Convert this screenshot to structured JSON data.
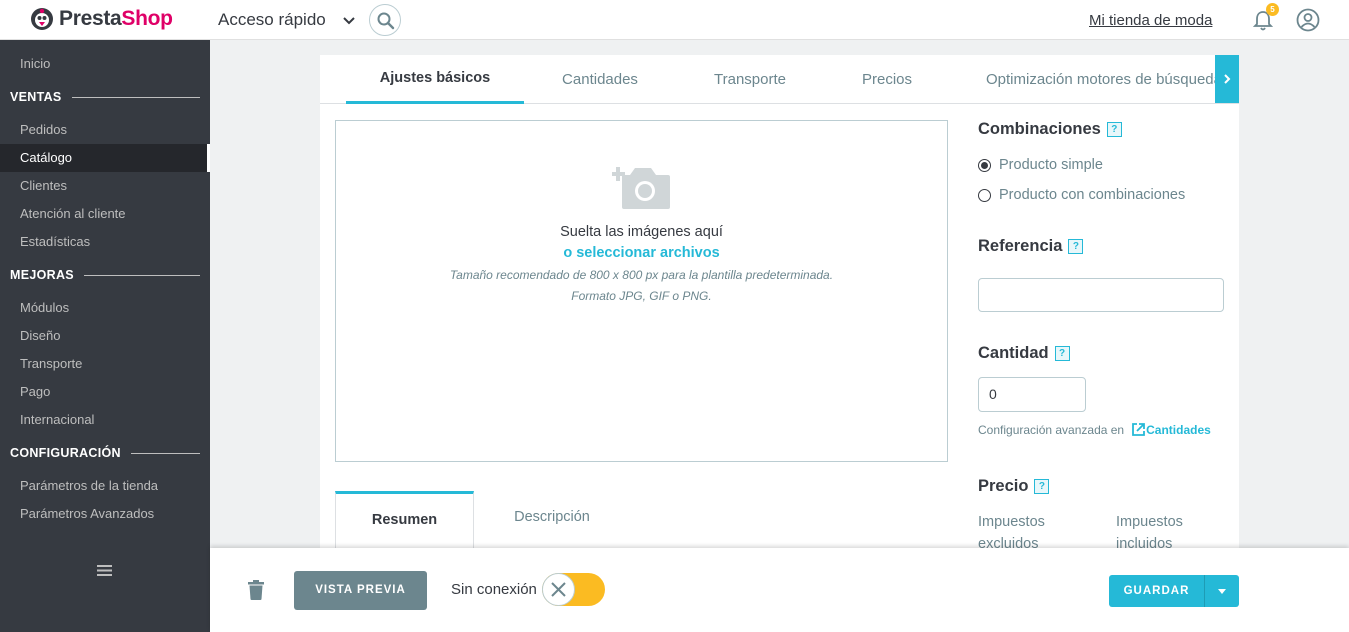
{
  "header": {
    "logo_part1": "Presta",
    "logo_part2": "Shop",
    "quick_access": "Acceso rápido",
    "shop_name": "Mi tienda de moda",
    "notification_count": "5"
  },
  "sidebar": {
    "home": "Inicio",
    "sections": [
      {
        "title": "VENTAS",
        "items": [
          "Pedidos",
          "Catálogo",
          "Clientes",
          "Atención al cliente",
          "Estadísticas"
        ]
      },
      {
        "title": "MEJORAS",
        "items": [
          "Módulos",
          "Diseño",
          "Transporte",
          "Pago",
          "Internacional"
        ]
      },
      {
        "title": "CONFIGURACIÓN",
        "items": [
          "Parámetros de la tienda",
          "Parámetros Avanzados"
        ]
      }
    ],
    "active_item": "Catálogo"
  },
  "tabs": [
    "Ajustes básicos",
    "Cantidades",
    "Transporte",
    "Precios",
    "Optimización motores de búsqueda"
  ],
  "dropzone": {
    "title": "Suelta las imágenes aquí",
    "link": "o seleccionar archivos",
    "hint1": "Tamaño recomendado de 800 x 800 px para la plantilla predeterminada.",
    "hint2": "Formato JPG, GIF o PNG."
  },
  "subtabs": [
    "Resumen",
    "Descripción"
  ],
  "right": {
    "combinations_label": "Combinaciones",
    "option_simple": "Producto simple",
    "option_combinations": "Producto con combinaciones",
    "reference_label": "Referencia",
    "reference_value": "",
    "quantity_label": "Cantidad",
    "quantity_value": "0",
    "advanced_text": "Configuración avanzada en",
    "advanced_link": "Cantidades",
    "price_label": "Precio",
    "tax_excluded": "Impuestos excluidos",
    "tax_included": "Impuestos incluidos",
    "help_glyph": "?"
  },
  "footer": {
    "preview": "VISTA PREVIA",
    "offline": "Sin conexión",
    "save": "GUARDAR"
  },
  "colors": {
    "accent": "#25b9d7",
    "sidebar_bg": "#363a41",
    "toggle": "#fbbb22",
    "brand_pink": "#df0067"
  }
}
